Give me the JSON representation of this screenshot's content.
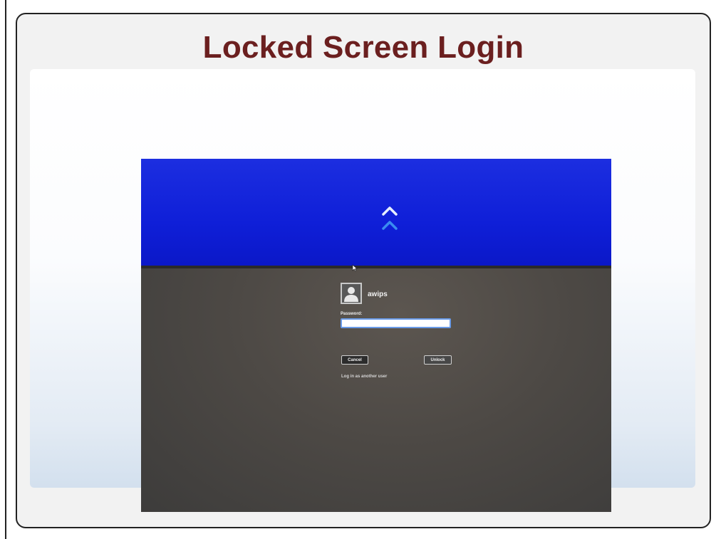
{
  "slide": {
    "title": "Locked Screen Login"
  },
  "lock_screen": {
    "username": "awips",
    "password_label": "Password:",
    "password_value": "",
    "cancel_label": "Cancel",
    "unlock_label": "Unlock",
    "other_user_link": "Log in as another user"
  },
  "icons": [
    "chevron-up-icon",
    "pointer-cursor-icon",
    "user-avatar-icon"
  ],
  "colors": {
    "title": "#6b1f1f",
    "lock_screen_top": "#1126dd",
    "lock_screen_bottom": "#4a4846",
    "chevron_upper": "#e6eeff",
    "chevron_lower": "#3a8cf0",
    "input_focus_border": "#6a9be8"
  }
}
